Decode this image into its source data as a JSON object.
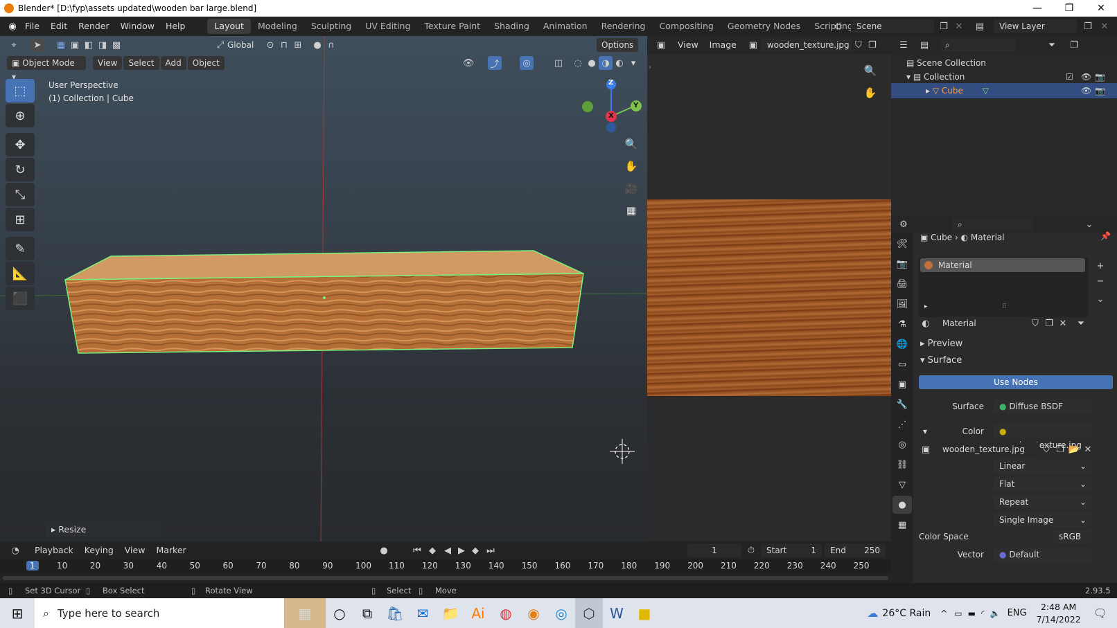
{
  "window": {
    "title": "Blender* [D:\\fyp\\assets updated\\wooden bar large.blend]",
    "minimize": "—",
    "maximize": "❐",
    "close": "✕"
  },
  "menus": [
    "File",
    "Edit",
    "Render",
    "Window",
    "Help"
  ],
  "workspaces": [
    "Layout",
    "Modeling",
    "Sculpting",
    "UV Editing",
    "Texture Paint",
    "Shading",
    "Animation",
    "Rendering",
    "Compositing",
    "Geometry Nodes",
    "Scripting"
  ],
  "add_workspace": "+",
  "scene": {
    "label": "Scene",
    "view_layer": "View Layer"
  },
  "viewport": {
    "transform": "Global",
    "options": "Options",
    "mode": "Object Mode",
    "header_menus": [
      "View",
      "Select",
      "Add",
      "Object"
    ],
    "perspective": "User Perspective",
    "collection_info": "(1) Collection | Cube",
    "gizmo": {
      "z": "Z",
      "y": "Y",
      "x": "X"
    },
    "last_op": "Resize"
  },
  "image_editor": {
    "menus": [
      "View",
      "Image"
    ],
    "image_name": "wooden_texture.jpg"
  },
  "outliner": {
    "root": "Scene Collection",
    "collection": "Collection",
    "object": "Cube"
  },
  "properties": {
    "breadcrumb": [
      "Cube",
      "Material"
    ],
    "slot": "Material",
    "material_name": "Material",
    "panels": {
      "preview": "Preview",
      "surface": "Surface"
    },
    "use_nodes": "Use Nodes",
    "surface_label": "Surface",
    "surface_value": "Diffuse BSDF",
    "color_label": "Color",
    "color_value": "wooden_texture.jpg",
    "image_name": "wooden_texture.jpg",
    "interp": "Linear",
    "projection": "Flat",
    "extension": "Repeat",
    "source": "Single Image",
    "colorspace_label": "Color Space",
    "colorspace_value": "sRGB",
    "vector_label": "Vector",
    "vector_value": "Default",
    "colors": {
      "accent": "#4772b3",
      "material_dot": "#c8b000",
      "socket_green": "#3db36b"
    }
  },
  "timeline": {
    "menus": [
      "Playback",
      "Keying",
      "View",
      "Marker"
    ],
    "current_frame": "1",
    "start_label": "Start",
    "start": "1",
    "end_label": "End",
    "end": "250",
    "ruler": [
      "1",
      "10",
      "20",
      "30",
      "40",
      "50",
      "60",
      "70",
      "80",
      "90",
      "100",
      "110",
      "120",
      "130",
      "140",
      "150",
      "160",
      "170",
      "180",
      "190",
      "200",
      "210",
      "220",
      "230",
      "240",
      "250"
    ]
  },
  "status": {
    "items": [
      "Set 3D Cursor",
      "Box Select",
      "Rotate View",
      "Select",
      "Move"
    ],
    "version": "2.93.5"
  },
  "taskbar": {
    "search": "Type here to search",
    "weather": "26°C  Rain",
    "lang": "ENG",
    "time": "2:48 AM",
    "date": "7/14/2022"
  }
}
